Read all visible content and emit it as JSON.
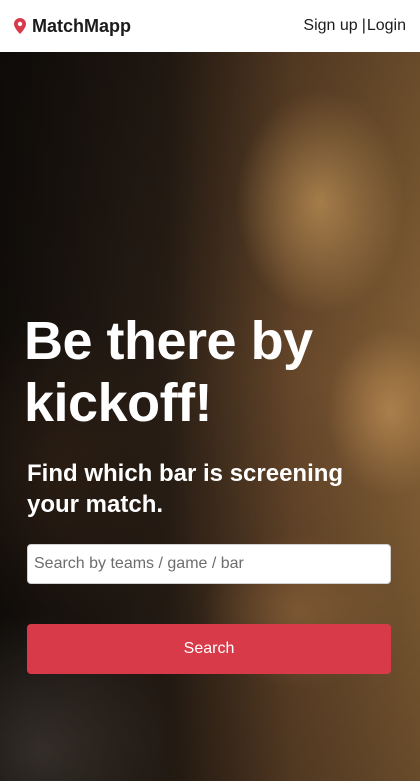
{
  "header": {
    "brand_name": "MatchMapp",
    "brand_icon": "map-pin-icon",
    "signup_label": "Sign up",
    "separator": "|",
    "login_label": "Login"
  },
  "hero": {
    "headline": "Be there by kickoff!",
    "subheadline": "Find which bar is screening your match.",
    "search": {
      "placeholder": "Search by teams / game / bar",
      "value": ""
    },
    "search_button_label": "Search"
  },
  "colors": {
    "brand_pin": "#d93a4a",
    "primary_button": "#d93a4a",
    "header_bg": "#ffffff",
    "text_light": "#ffffff"
  }
}
